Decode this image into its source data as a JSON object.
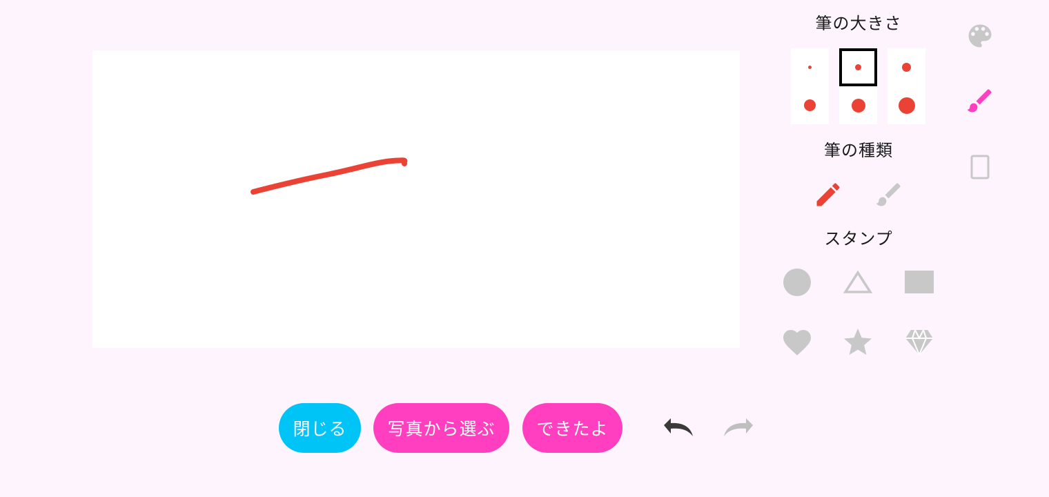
{
  "canvas": {
    "background": "#ffffff",
    "stroke_color": "#ea4335"
  },
  "brush_size": {
    "title": "筆の大きさ",
    "selected_index": 1,
    "color": "#ea4335"
  },
  "brush_type": {
    "title": "筆の種類",
    "items": [
      {
        "name": "pencil-icon",
        "selected": true
      },
      {
        "name": "brush-icon",
        "selected": false
      }
    ]
  },
  "stamps": {
    "title": "スタンプ",
    "items": [
      "circle-icon",
      "triangle-icon",
      "rectangle-icon",
      "heart-icon",
      "star-icon",
      "diamond-icon"
    ],
    "color": "#c8c8c8"
  },
  "side_tools": [
    {
      "name": "palette-icon",
      "active": false
    },
    {
      "name": "brush-icon",
      "active": true
    },
    {
      "name": "eraser-icon",
      "active": false
    }
  ],
  "buttons": {
    "close": "閉じる",
    "choose_photo": "写真から選ぶ",
    "done": "できたよ"
  },
  "colors": {
    "background": "#fdf4fd",
    "close_button": "#00c4f5",
    "action_button": "#ff3ec0",
    "active_tool": "#ff3ec0",
    "inactive_tool": "#c8c8c8",
    "undo": "#3a3a3a",
    "redo": "#bfbfbf"
  },
  "history": {
    "undo_enabled": true,
    "redo_enabled": false
  }
}
